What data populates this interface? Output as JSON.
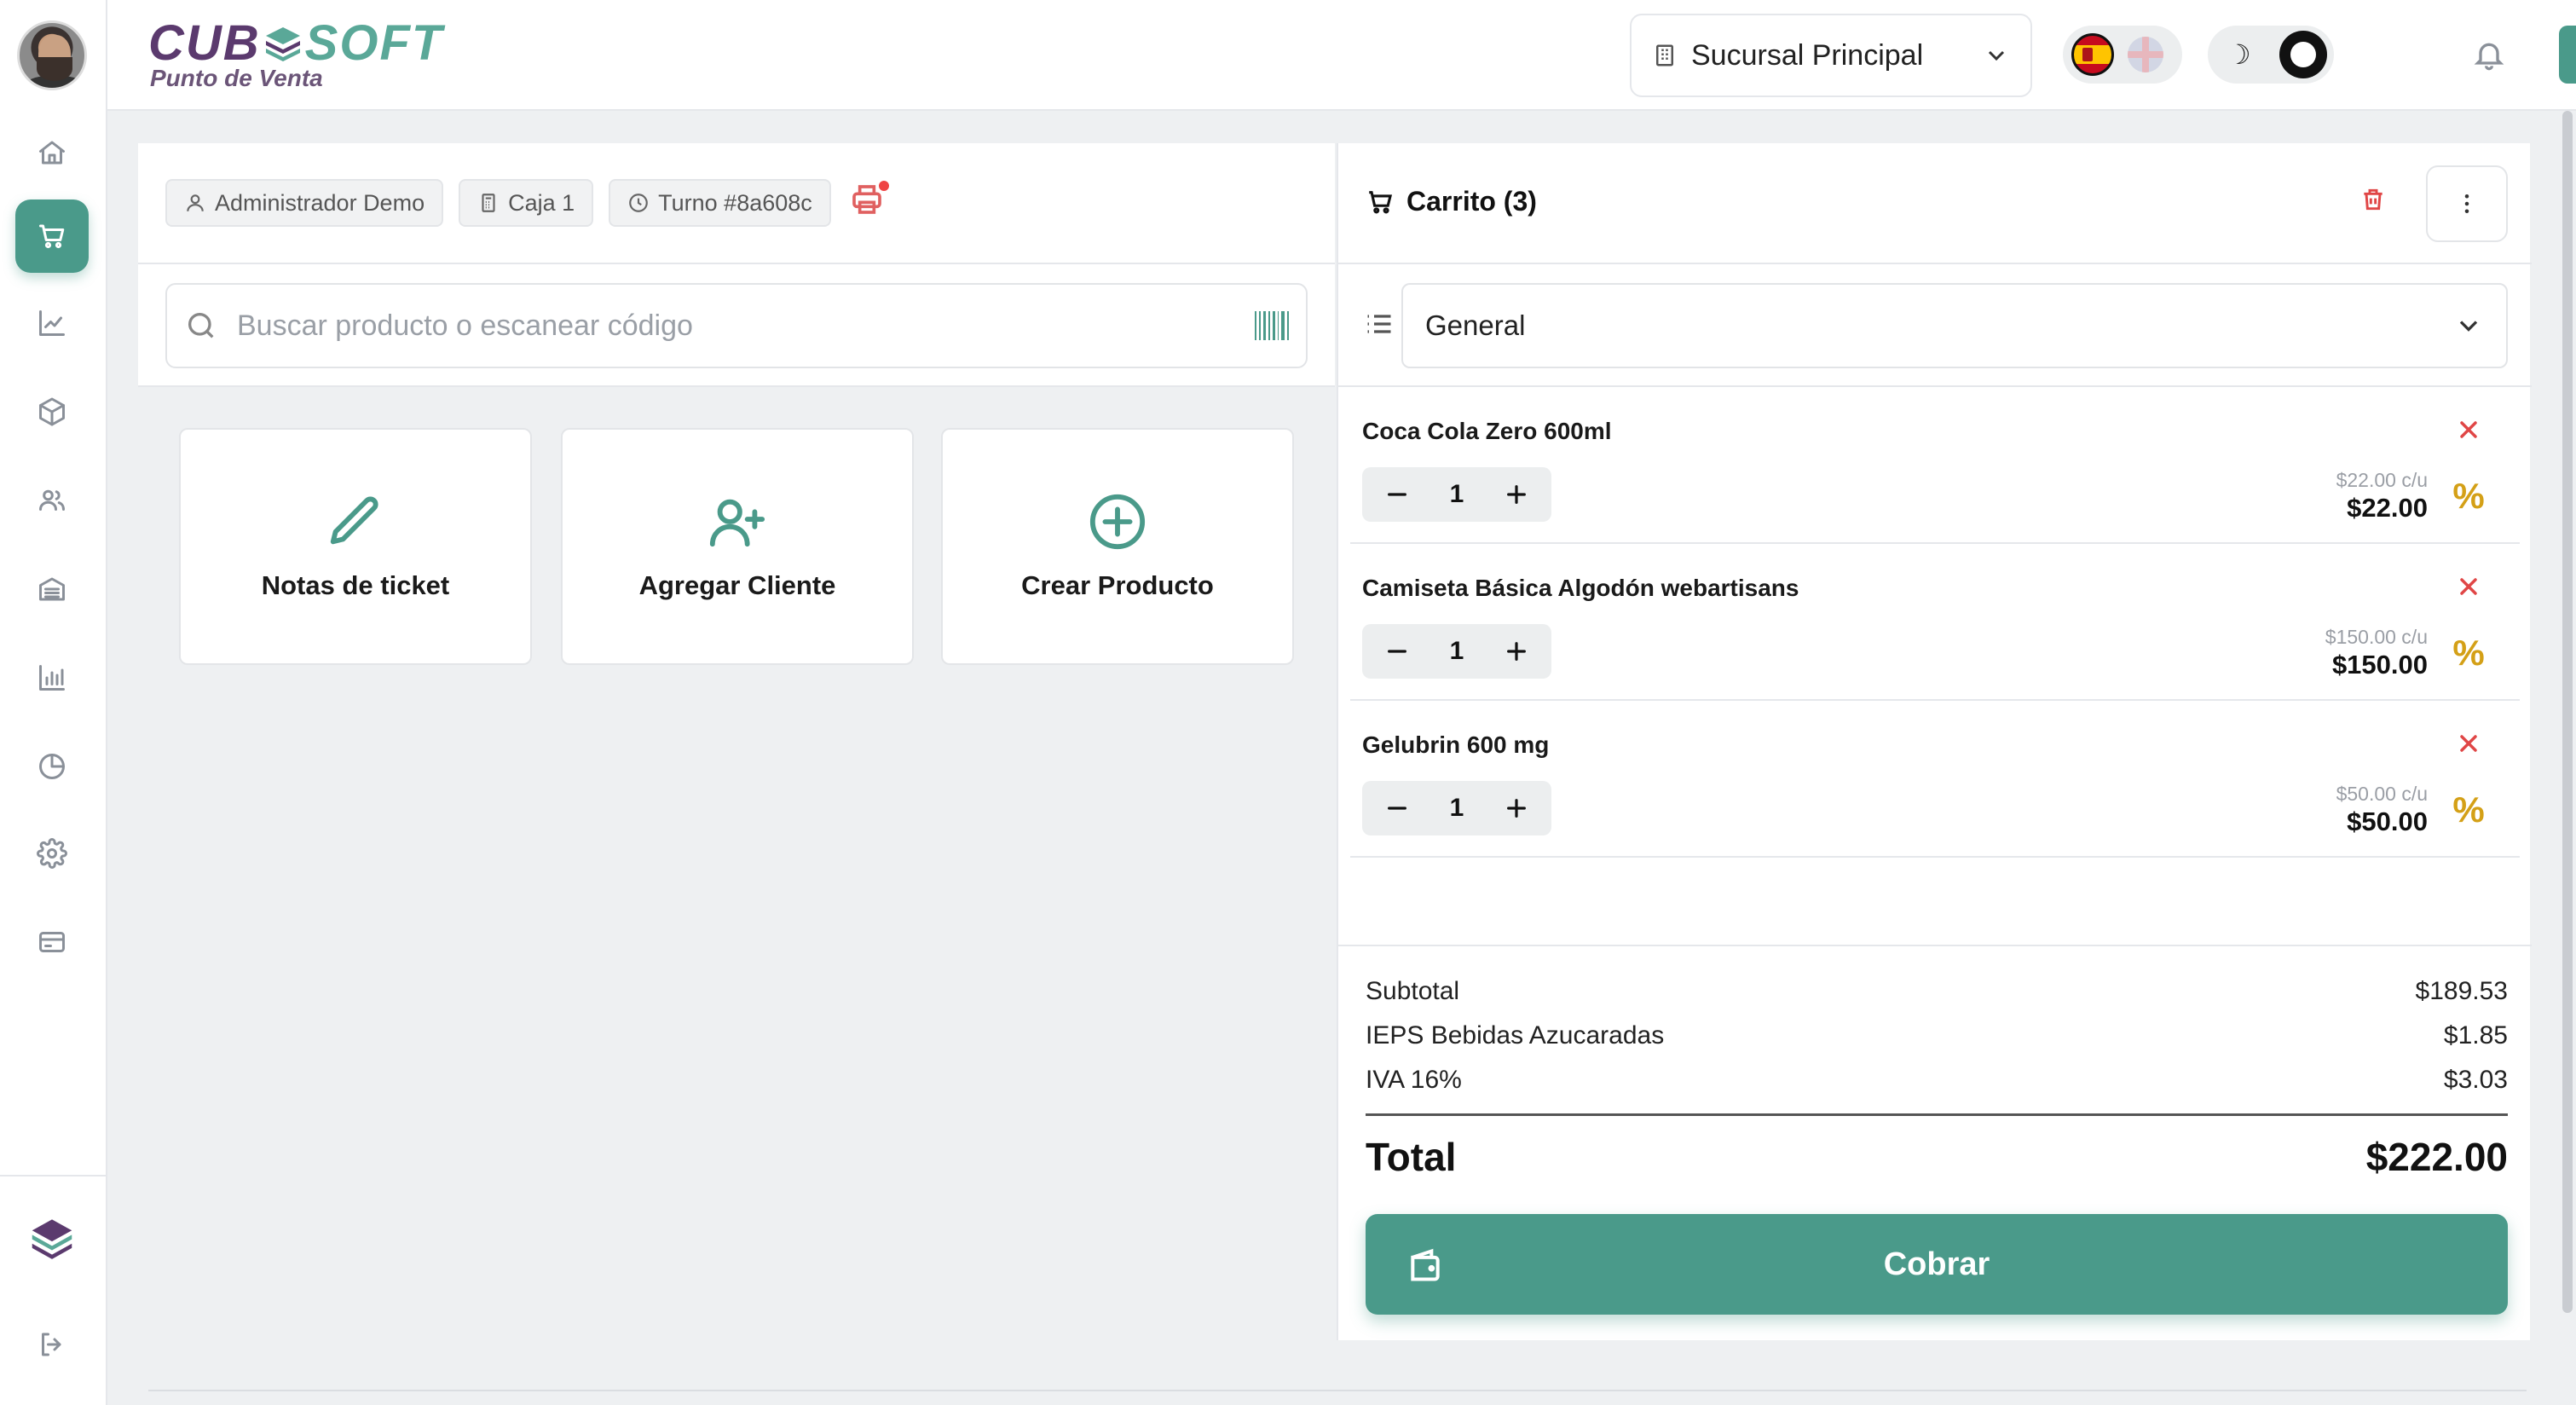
{
  "app": {
    "logo_left": "CUB",
    "logo_right": "SOFT",
    "logo_subtitle": "Punto de Venta"
  },
  "header": {
    "branch": "Sucursal Principal",
    "languages": [
      "es",
      "en"
    ],
    "theme_icons": [
      "moon-icon",
      "sun-icon"
    ]
  },
  "sidebar": {
    "items": [
      {
        "name": "home",
        "icon": "home-icon",
        "active": false
      },
      {
        "name": "pos",
        "icon": "cart-icon",
        "active": true
      },
      {
        "name": "sales",
        "icon": "trend-icon",
        "active": false
      },
      {
        "name": "inventory",
        "icon": "box-icon",
        "active": false
      },
      {
        "name": "customers",
        "icon": "users-icon",
        "active": false
      },
      {
        "name": "warehouse",
        "icon": "warehouse-icon",
        "active": false
      },
      {
        "name": "reports",
        "icon": "bar-chart-icon",
        "active": false
      },
      {
        "name": "analytics",
        "icon": "pie-chart-icon",
        "active": false
      },
      {
        "name": "settings",
        "icon": "gear-icon",
        "active": false
      },
      {
        "name": "billing",
        "icon": "credit-card-icon",
        "active": false
      }
    ]
  },
  "session": {
    "user": "Administrador Demo",
    "register": "Caja 1",
    "shift": "Turno #8a608c"
  },
  "search": {
    "placeholder": "Buscar producto o escanear código"
  },
  "quick_actions": [
    {
      "label": "Notas de ticket",
      "icon": "pencil-icon"
    },
    {
      "label": "Agregar Cliente",
      "icon": "user-plus-icon"
    },
    {
      "label": "Crear Producto",
      "icon": "plus-circle-icon"
    }
  ],
  "cart": {
    "title": "Carrito (3)",
    "price_list": "General",
    "items": [
      {
        "name": "Coca Cola Zero 600ml",
        "qty": "1",
        "unit_price": "$22.00 c/u",
        "total": "$22.00"
      },
      {
        "name": "Camiseta Básica Algodón webartisans",
        "qty": "1",
        "unit_price": "$150.00 c/u",
        "total": "$150.00"
      },
      {
        "name": "Gelubrin 600 mg",
        "qty": "1",
        "unit_price": "$50.00 c/u",
        "total": "$50.00"
      }
    ],
    "discount_symbol": "%",
    "summary": {
      "subtotal_label": "Subtotal",
      "subtotal": "$189.53",
      "ieps_label": "IEPS Bebidas Azucaradas",
      "ieps": "$1.85",
      "iva_label": "IVA 16%",
      "iva": "$3.03",
      "total_label": "Total",
      "total": "$222.00"
    },
    "charge_label": "Cobrar"
  },
  "colors": {
    "accent": "#4a9a8a",
    "brand_purple": "#5b3a6e",
    "danger": "#e04646",
    "discount": "#d4a017"
  }
}
